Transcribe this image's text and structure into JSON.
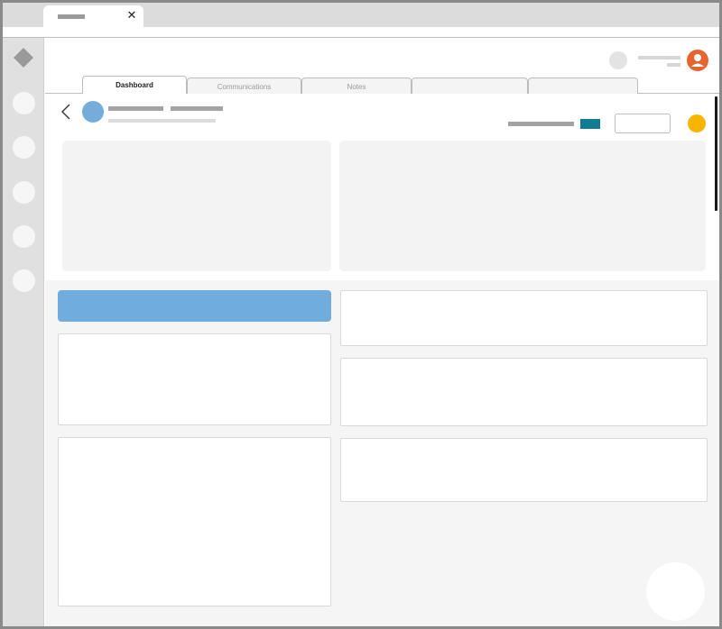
{
  "browser": {
    "tab_close_glyph": "✕"
  },
  "subtabs": [
    {
      "label": "Dashboard",
      "active": true
    },
    {
      "label": "Communications",
      "active": false
    },
    {
      "label": "Notes",
      "active": false
    },
    {
      "label": "",
      "active": false
    },
    {
      "label": "",
      "active": false
    }
  ],
  "icons": {
    "app_logo": "diamond-logo-icon",
    "back": "chevron-left-icon",
    "close": "close-icon",
    "user": "user-avatar-icon"
  },
  "colors": {
    "accent_blue": "#71acde",
    "teal": "#0f7c93",
    "yellow": "#f7b500",
    "avatar_orange": "#e8642e"
  }
}
